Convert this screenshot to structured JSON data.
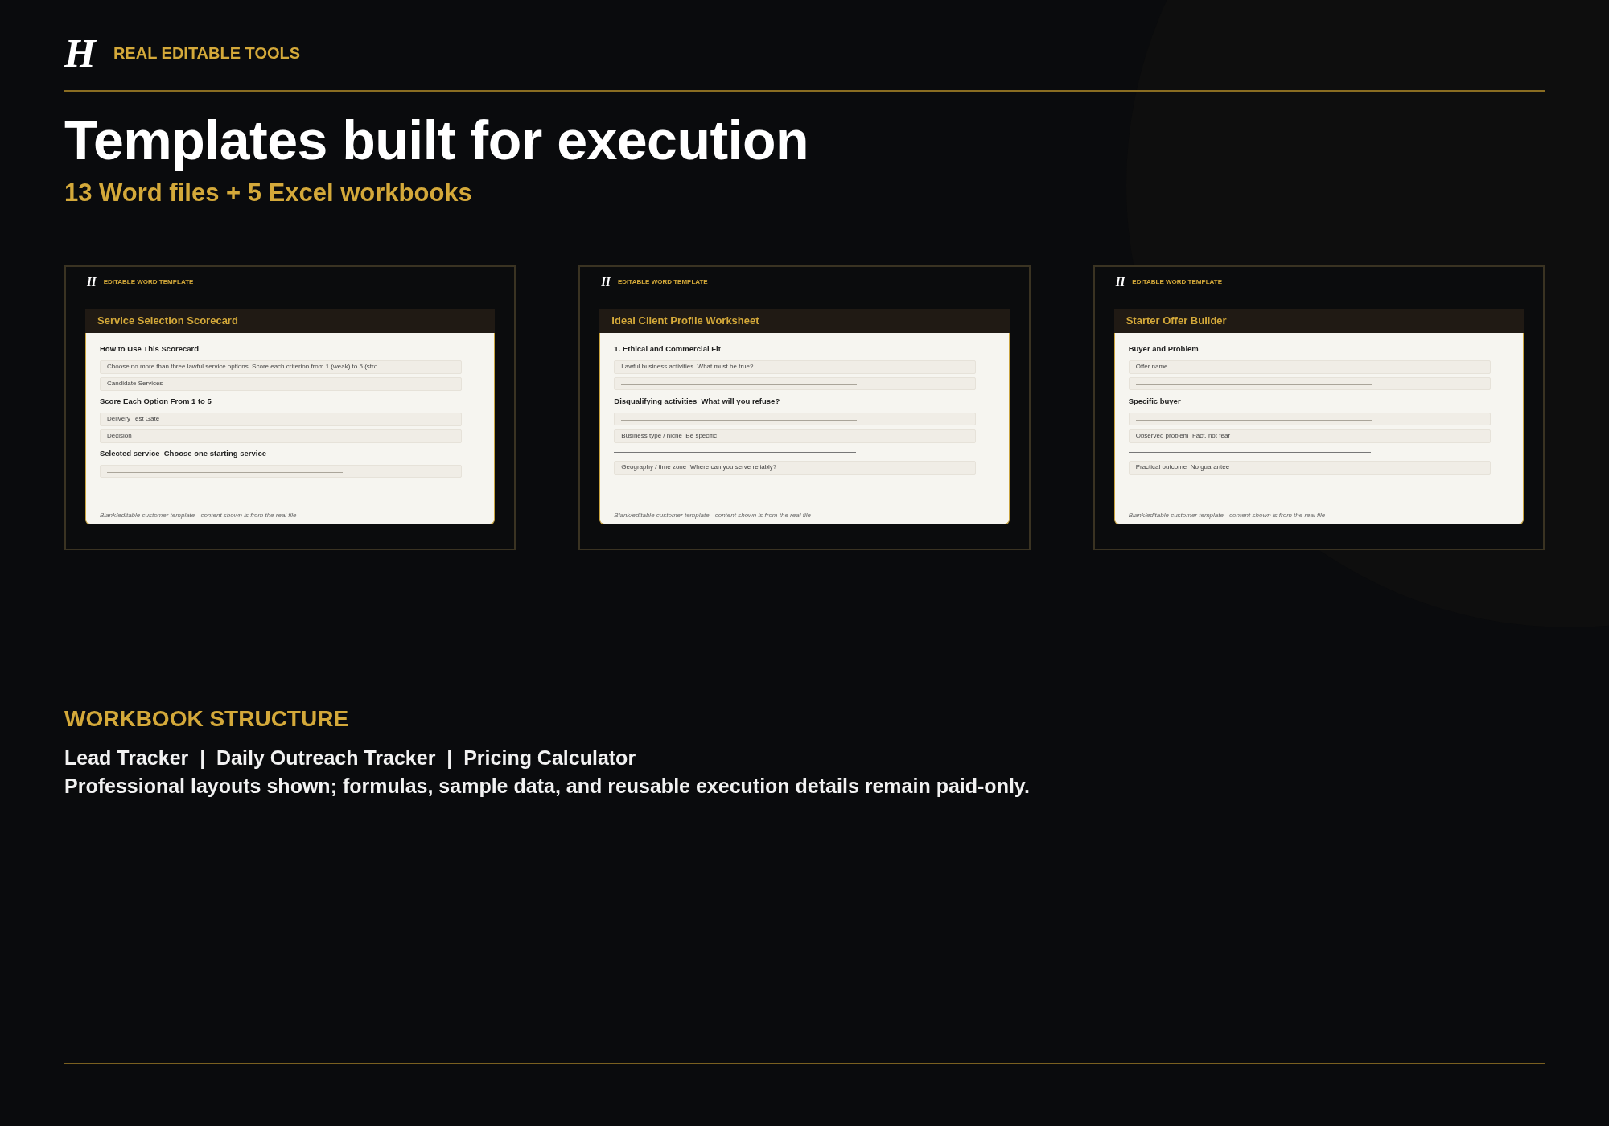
{
  "header": {
    "logo": "H",
    "label": "REAL EDITABLE TOOLS"
  },
  "title": "Templates built for execution",
  "subtitle": "13 Word files + 5 Excel workbooks",
  "templates": [
    {
      "logo": "H",
      "label": "EDITABLE WORD TEMPLATE",
      "title": "Service Selection Scorecard",
      "footnote": "Blank/editable customer template - content shown is from the real file",
      "items": [
        {
          "kind": "heading",
          "text": "How to Use This Scorecard"
        },
        {
          "kind": "field",
          "text": "Choose no more than three lawful service options. Score each criterion from 1 (weak) to 5 (stro"
        },
        {
          "kind": "field",
          "text": "Candidate Services"
        },
        {
          "kind": "heading",
          "text": "Score Each Option From 1 to 5"
        },
        {
          "kind": "field",
          "text": "Delivery Test Gate"
        },
        {
          "kind": "field",
          "text": "Decision"
        },
        {
          "kind": "heading",
          "text": "Selected service  Choose one starting service"
        },
        {
          "kind": "blank"
        }
      ]
    },
    {
      "logo": "H",
      "label": "EDITABLE WORD TEMPLATE",
      "title": "Ideal Client Profile Worksheet",
      "footnote": "Blank/editable customer template - content shown is from the real file",
      "items": [
        {
          "kind": "heading",
          "text": "1. Ethical and Commercial Fit"
        },
        {
          "kind": "field",
          "text": "Lawful business activities  What must be true?"
        },
        {
          "kind": "blank"
        },
        {
          "kind": "heading",
          "text": "Disqualifying activities  What will you refuse?"
        },
        {
          "kind": "blank"
        },
        {
          "kind": "field",
          "text": "Business type / niche  Be specific"
        },
        {
          "kind": "rule"
        },
        {
          "kind": "field",
          "text": "Geography / time zone  Where can you serve reliably?"
        }
      ]
    },
    {
      "logo": "H",
      "label": "EDITABLE WORD TEMPLATE",
      "title": "Starter Offer Builder",
      "footnote": "Blank/editable customer template - content shown is from the real file",
      "items": [
        {
          "kind": "heading",
          "text": "Buyer and Problem"
        },
        {
          "kind": "field",
          "text": "Offer name"
        },
        {
          "kind": "blank"
        },
        {
          "kind": "heading",
          "text": "Specific buyer"
        },
        {
          "kind": "blank"
        },
        {
          "kind": "field",
          "text": "Observed problem  Fact, not fear"
        },
        {
          "kind": "rule"
        },
        {
          "kind": "field",
          "text": "Practical outcome  No guarantee"
        }
      ]
    }
  ],
  "workbook": {
    "heading": "WORKBOOK STRUCTURE",
    "lines": [
      "Lead Tracker  |  Daily Outreach Tracker  |  Pricing Calculator",
      "Professional layouts shown; formulas, sample data, and reusable execution details remain paid-only."
    ]
  }
}
